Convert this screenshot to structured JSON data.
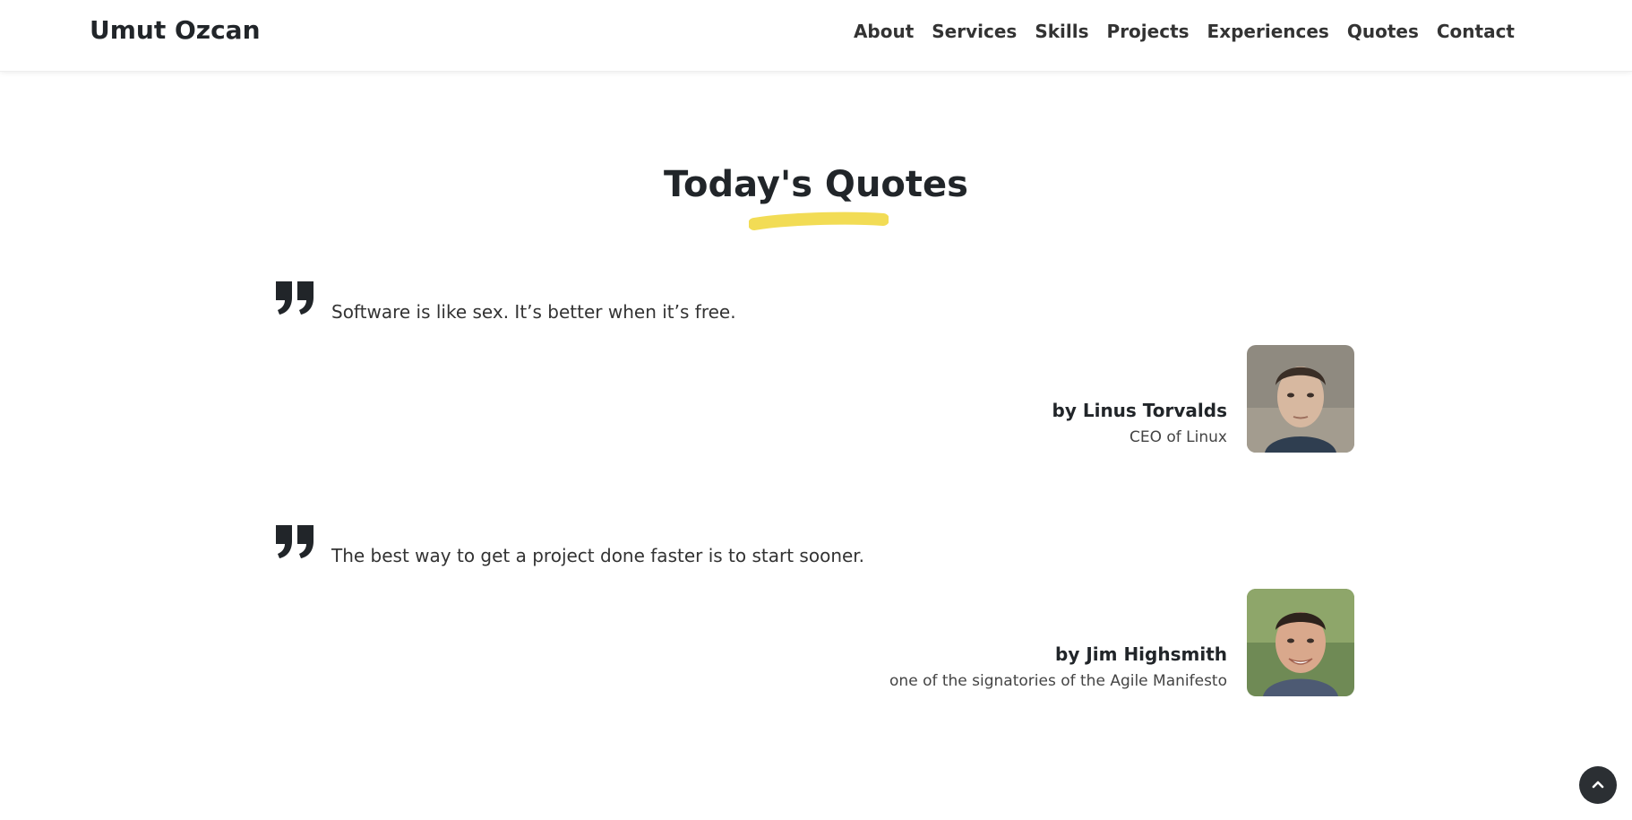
{
  "header": {
    "brand": "Umut Ozcan",
    "nav": [
      "About",
      "Services",
      "Skills",
      "Projects",
      "Experiences",
      "Quotes",
      "Contact"
    ]
  },
  "section": {
    "title": "Today's Quotes",
    "accent_color": "#f2dc55"
  },
  "quotes": [
    {
      "text": "Software is like sex. It’s better when it’s free.",
      "author": "by Linus Torvalds",
      "role": "CEO of Linux"
    },
    {
      "text": "The best way to get a project done faster is to start sooner.",
      "author": "by Jim Highsmith",
      "role": "one of the signatories of the Agile Manifesto"
    }
  ],
  "icons": {
    "quote": "quote-icon",
    "scroll_top": "chevron-up-icon"
  }
}
